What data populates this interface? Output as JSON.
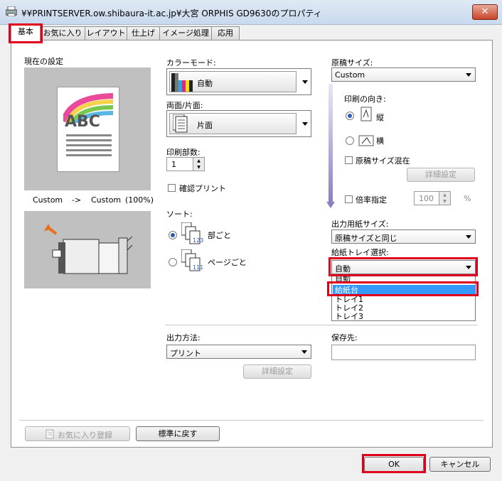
{
  "window": {
    "title": "¥¥PRINTSERVER.ow.shibaura-it.ac.jp¥大宮 ORPHIS GD9630のプロパティ",
    "close_glyph": "✕"
  },
  "tabs": [
    {
      "label": "基本"
    },
    {
      "label": "お気に入り"
    },
    {
      "label": "レイアウト"
    },
    {
      "label": "仕上げ"
    },
    {
      "label": "イメージ処理"
    },
    {
      "label": "応用"
    }
  ],
  "current_settings": {
    "label": "現在の設定",
    "preview_text": "ABC",
    "from": "Custom",
    "arrow": "->",
    "to": "Custom",
    "scale": "(100%)"
  },
  "color_mode": {
    "label": "カラーモード:",
    "value": "自動"
  },
  "duplex": {
    "label": "両面/片面:",
    "value": "片面"
  },
  "copies": {
    "label": "印刷部数:",
    "value": "1"
  },
  "confirm_print": {
    "label": "確認プリント",
    "checked": false
  },
  "sort": {
    "label": "ソート:",
    "options": [
      {
        "label": "部ごと",
        "selected": true
      },
      {
        "label": "ページごと",
        "selected": false
      }
    ]
  },
  "original_size": {
    "label": "原稿サイズ:",
    "value": "Custom"
  },
  "orientation": {
    "label": "印刷の向き:",
    "portrait": "縦",
    "landscape": "横",
    "selected": "portrait"
  },
  "mixed_sizes": {
    "label": "原稿サイズ混在",
    "checked": false
  },
  "detail_button": "詳細設定",
  "zoom": {
    "label": "倍率指定",
    "value": "100",
    "unit": "%"
  },
  "paper_size": {
    "label": "出力用紙サイズ:",
    "value": "原稿サイズと同じ"
  },
  "tray": {
    "label": "給紙トレイ選択:",
    "value": "自動",
    "options": [
      "自動",
      "給紙台",
      "トレイ1",
      "トレイ2",
      "トレイ3"
    ],
    "highlighted": "給紙台"
  },
  "output_method": {
    "label": "出力方法:",
    "value": "プリント",
    "detail_button": "詳細設定"
  },
  "save_to": {
    "label": "保存先:",
    "value": ""
  },
  "footer": {
    "favorite_button": "お気に入り登録",
    "reset_button": "標準に戻す"
  },
  "dialog": {
    "ok": "OK",
    "cancel": "キャンセル"
  },
  "colors": {
    "highlight": "#3399ff",
    "annotation_red": "#e0001b",
    "arrow_purple": "#8a7fc0"
  }
}
